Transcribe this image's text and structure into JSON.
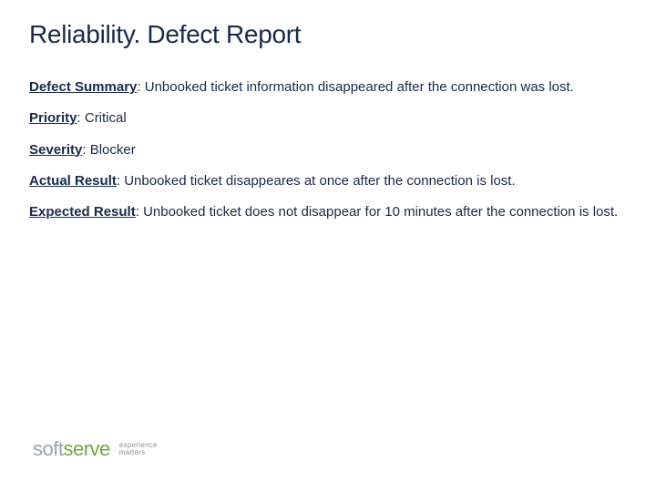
{
  "title": "Reliability. Defect Report",
  "fields": {
    "summary": {
      "label": "Defect Summary",
      "value": "Unbooked ticket information disappeared after the connection was lost."
    },
    "priority": {
      "label": "Priority",
      "value": "Critical"
    },
    "severity": {
      "label": "Severity",
      "value": "Blocker"
    },
    "actual": {
      "label": "Actual Result",
      "value": "Unbooked ticket disappeares at once after the connection is lost."
    },
    "expected": {
      "label": "Expected Result",
      "value": "Unbooked ticket does not disappear  for 10 minutes after the connection is lost."
    }
  },
  "logo": {
    "part1": "soft",
    "part2": "serve",
    "tagline1": "experience",
    "tagline2": "matters"
  }
}
